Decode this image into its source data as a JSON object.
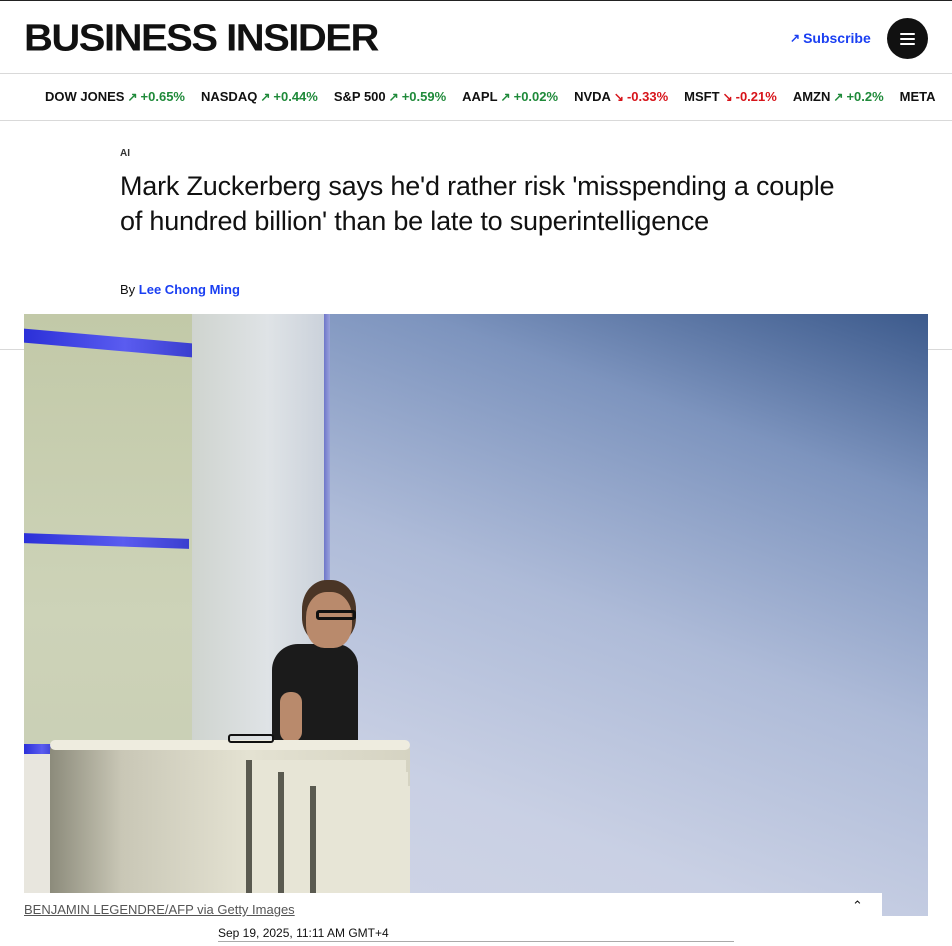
{
  "header": {
    "logo": "BUSINESS INSIDER",
    "subscribe_label": "Subscribe",
    "subscribe_icon": "arrow-up-right-icon",
    "menu_icon": "hamburger-menu-icon",
    "accent_color": "#1a3ff2"
  },
  "ticker": [
    {
      "symbol": "DOW JONES",
      "direction": "up",
      "change": "+0.65%"
    },
    {
      "symbol": "NASDAQ",
      "direction": "up",
      "change": "+0.44%"
    },
    {
      "symbol": "S&P 500",
      "direction": "up",
      "change": "+0.59%"
    },
    {
      "symbol": "AAPL",
      "direction": "up",
      "change": "+0.02%"
    },
    {
      "symbol": "NVDA",
      "direction": "down",
      "change": "-0.33%"
    },
    {
      "symbol": "MSFT",
      "direction": "down",
      "change": "-0.21%"
    },
    {
      "symbol": "AMZN",
      "direction": "up",
      "change": "+0.2%"
    },
    {
      "symbol": "META",
      "direction": "",
      "change": ""
    }
  ],
  "ticker_colors": {
    "up": "#1f8a3a",
    "down": "#d7141a"
  },
  "article": {
    "category": "AI",
    "headline": "Mark Zuckerberg says he'd rather risk 'misspending a couple of hundred billion' than be late to superintelligence",
    "byline_prefix": "By",
    "author": "Lee Chong Ming",
    "image_credit": "BENJAMIN LEGENDRE/AFP via Getty Images",
    "collapse_icon": "chevron-up-icon",
    "timestamp": "Sep 19, 2025, 11:11 AM GMT+4"
  }
}
